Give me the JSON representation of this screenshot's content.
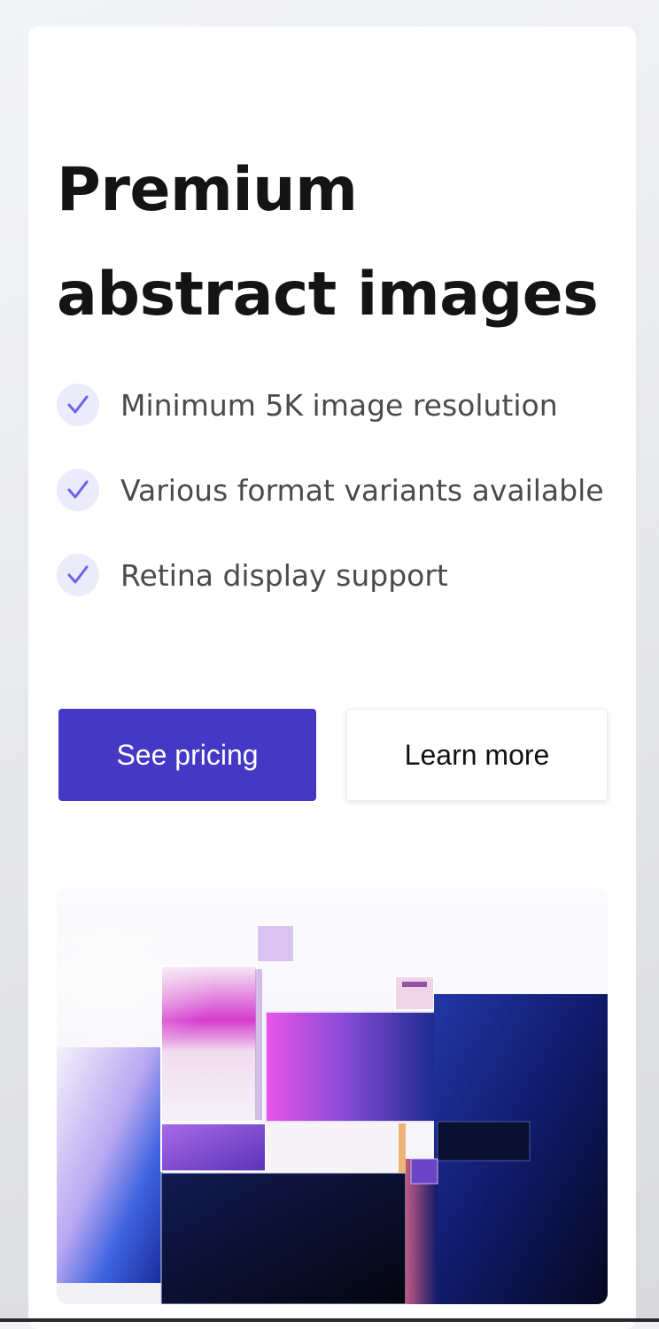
{
  "hero": {
    "title": "Premium abstract images",
    "features": [
      {
        "icon": "check-icon",
        "label": "Minimum 5K image resolution"
      },
      {
        "icon": "check-icon",
        "label": "Various format variants available"
      },
      {
        "icon": "check-icon",
        "label": "Retina display support"
      }
    ],
    "primary_button": {
      "label": "See pricing",
      "color": "#4438c4"
    },
    "secondary_button": {
      "label": "Learn more"
    },
    "accent_color": "#6c63e6"
  }
}
